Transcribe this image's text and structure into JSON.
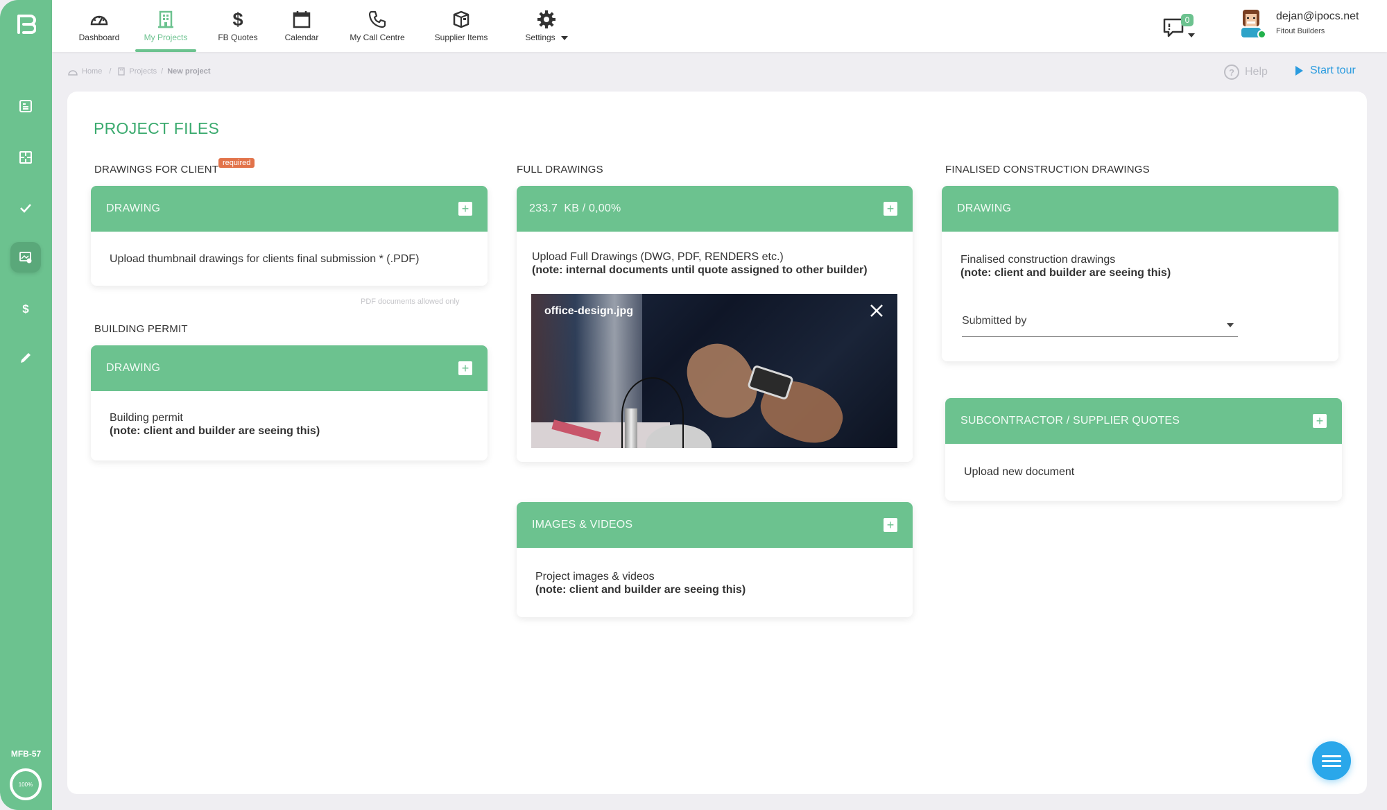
{
  "app": {
    "logo": "FB",
    "project_code": "MFB-57",
    "project_progress_percent": 100,
    "project_progress_label": "100%"
  },
  "sidebar": {
    "items": [
      {
        "icon": "document-list-icon",
        "active": false
      },
      {
        "icon": "floorplan-icon",
        "active": false
      },
      {
        "icon": "checkmark-icon",
        "active": false
      },
      {
        "icon": "image-files-icon",
        "active": true
      },
      {
        "icon": "dollar-icon",
        "active": false
      },
      {
        "icon": "pencil-icon",
        "active": false
      }
    ]
  },
  "nav": {
    "items": [
      {
        "label": "Dashboard",
        "icon": "speedometer-icon",
        "active": false
      },
      {
        "label": "My Projects",
        "icon": "building-icon",
        "active": true
      },
      {
        "label": "FB Quotes",
        "icon": "dollar-icon",
        "active": false
      },
      {
        "label": "Calendar",
        "icon": "calendar-icon",
        "active": false
      },
      {
        "label": "My Call Centre",
        "icon": "phone-icon",
        "active": false
      },
      {
        "label": "Supplier Items",
        "icon": "box-icon",
        "active": false
      },
      {
        "label": "Settings",
        "icon": "gear-icon",
        "active": false,
        "dropdown": true
      }
    ]
  },
  "header": {
    "notifications_count": "0",
    "user_email": "dejan@ipocs.net",
    "user_company": "Fitout Builders",
    "user_status": "online"
  },
  "breadcrumb": {
    "items": [
      "Home",
      "Projects",
      "New project"
    ]
  },
  "help_label": "Help",
  "start_tour_label": "Start tour",
  "page": {
    "title": "PROJECT FILES",
    "sections": {
      "drawings_for_client": {
        "label": "DRAWINGS FOR CLIENT",
        "badge": "required",
        "card_header": "DRAWING",
        "body": "Upload thumbnail drawings for clients final submission * (.PDF)",
        "hint": "PDF documents allowed only"
      },
      "building_permit": {
        "label": "BUILDING PERMIT",
        "card_header": "DRAWING",
        "body": "Building permit",
        "note": "(note: client and builder are seeing this)"
      },
      "full_drawings": {
        "label": "FULL DRAWINGS",
        "card_header": "233.7  KB / 0,00%",
        "body": "Upload Full Drawings (DWG, PDF, RENDERS etc.)",
        "note": "(note: internal documents until quote assigned to other builder)",
        "file_name": "office-design.jpg"
      },
      "images_videos": {
        "card_header": "IMAGES & VIDEOS",
        "body": "Project images & videos",
        "note": "(note: client and builder are seeing this)"
      },
      "finalised_construction": {
        "label": "FINALISED CONSTRUCTION DRAWINGS",
        "card_header": "DRAWING",
        "body": "Finalised construction drawings",
        "note": "(note: client and builder are seeing this)",
        "submitted_by_label": "Submitted by",
        "submitted_by_value": ""
      },
      "subcontractor_quotes": {
        "card_header": "SUBCONTRACTOR / SUPPLIER QUOTES",
        "body": "Upload new document"
      }
    }
  },
  "colors": {
    "brand_green": "#6cc28f",
    "title_green": "#3aaa6e",
    "required_orange": "#e2734a",
    "accent_blue": "#2aa7ea"
  }
}
